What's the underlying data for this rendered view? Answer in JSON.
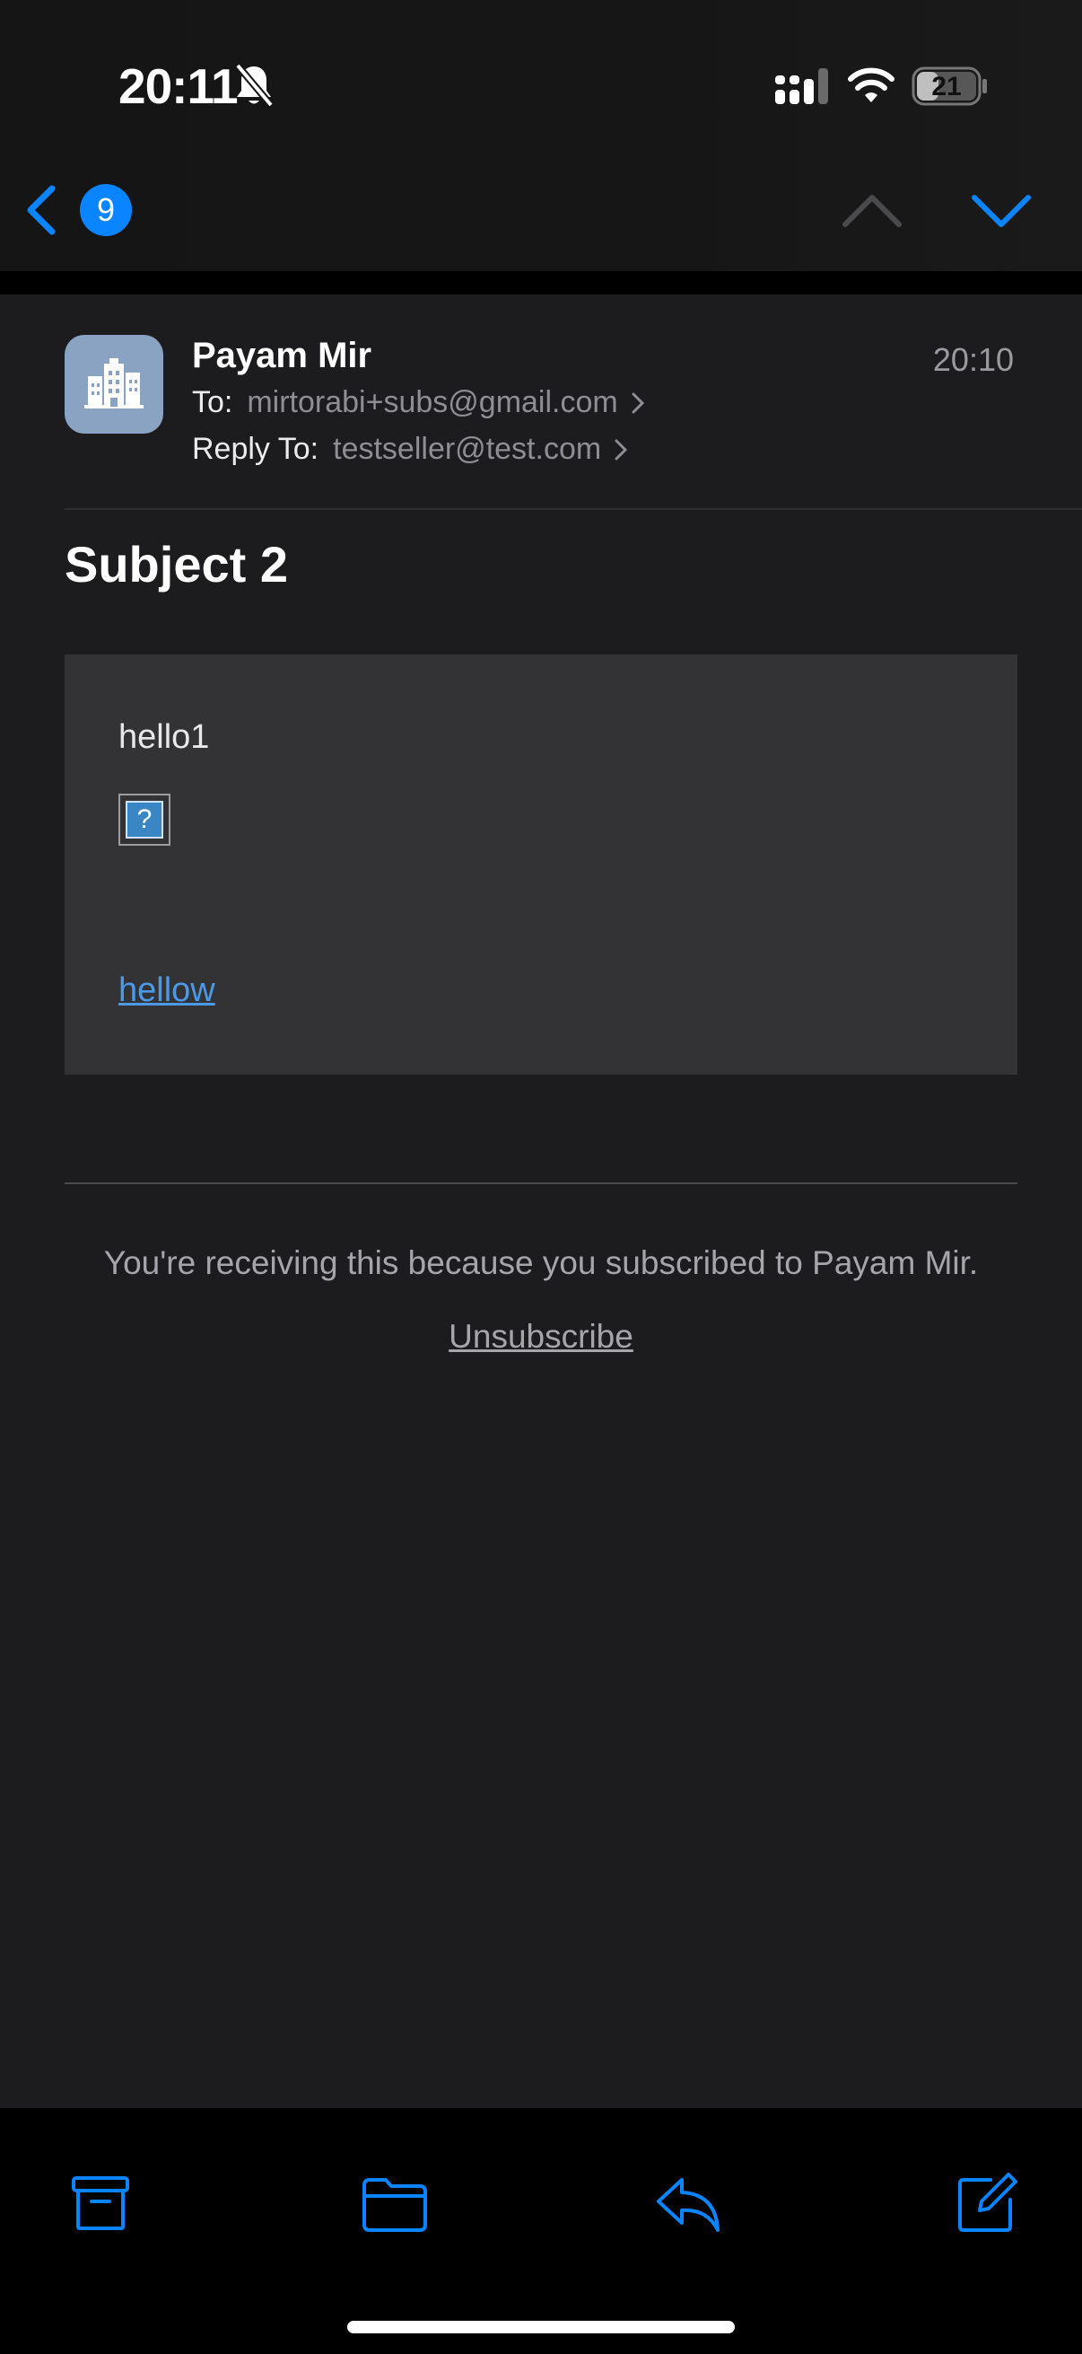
{
  "status": {
    "time": "20:11",
    "battery": "21",
    "icons": [
      "bell-slash-icon",
      "signal-icon",
      "wifi-icon",
      "battery-icon"
    ]
  },
  "nav": {
    "unread_count": "9",
    "icons": [
      "back-chevron-icon",
      "previous-message-icon",
      "next-message-icon"
    ]
  },
  "message": {
    "sender": "Payam Mir",
    "time": "20:10",
    "to_label": "To:",
    "to_value": "mirtorabi+subs@gmail.com",
    "reply_label": "Reply To:",
    "reply_value": "testseller@test.com",
    "subject": "Subject 2"
  },
  "body": {
    "text": "hello1",
    "image_placeholder": "?",
    "link": "hellow"
  },
  "footer": {
    "notice": "You're receiving this because you subscribed to Payam Mir.",
    "unsubscribe": "Unsubscribe"
  },
  "toolbar": {
    "icons": [
      "archive-icon",
      "move-folder-icon",
      "reply-icon",
      "compose-icon"
    ]
  },
  "colors": {
    "accent": "#0a84ff",
    "background": "#1c1c1e",
    "card": "#333335",
    "link": "#4b9ae8"
  }
}
